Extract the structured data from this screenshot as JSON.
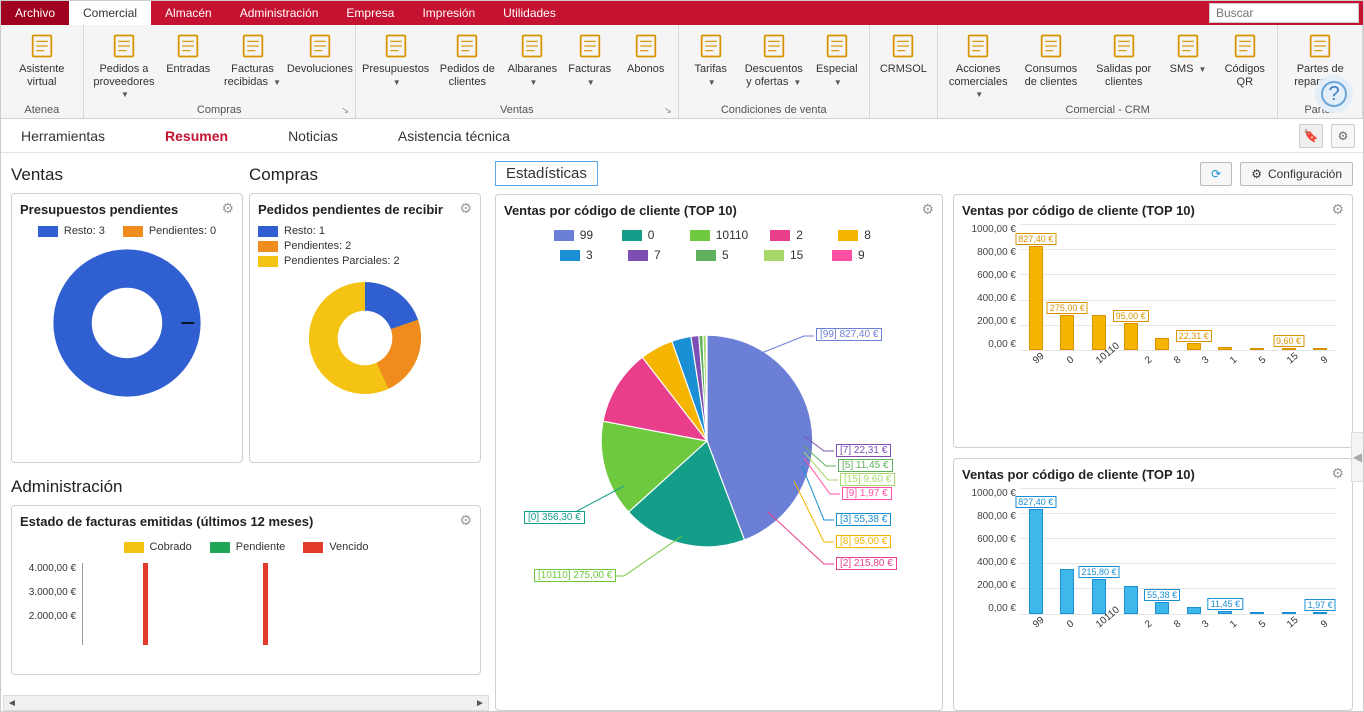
{
  "menu": {
    "items": [
      "Archivo",
      "Comercial",
      "Almacén",
      "Administración",
      "Empresa",
      "Impresión",
      "Utilidades"
    ],
    "active": 1,
    "search_placeholder": "Buscar"
  },
  "ribbon": {
    "groups": [
      {
        "title": "Atenea",
        "buttons": [
          {
            "name": "asistente-virtual",
            "label": "Asistente virtual"
          }
        ]
      },
      {
        "title": "Compras",
        "dlg": true,
        "buttons": [
          {
            "name": "pedidos-proveedores",
            "label": "Pedidos a proveedores",
            "caret": true
          },
          {
            "name": "entradas",
            "label": "Entradas"
          },
          {
            "name": "facturas-recibidas",
            "label": "Facturas recibidas",
            "caret": true
          },
          {
            "name": "devoluciones",
            "label": "Devoluciones"
          }
        ]
      },
      {
        "title": "Ventas",
        "dlg": true,
        "buttons": [
          {
            "name": "presupuestos",
            "label": "Presupuestos",
            "caret": true
          },
          {
            "name": "pedidos-clientes",
            "label": "Pedidos de clientes"
          },
          {
            "name": "albaranes",
            "label": "Albaranes",
            "caret": true
          },
          {
            "name": "facturas",
            "label": "Facturas",
            "caret": true
          },
          {
            "name": "abonos",
            "label": "Abonos"
          }
        ]
      },
      {
        "title": "Condiciones de venta",
        "buttons": [
          {
            "name": "tarifas",
            "label": "Tarifas",
            "caret": true
          },
          {
            "name": "descuentos-ofertas",
            "label": "Descuentos y ofertas",
            "caret": true
          },
          {
            "name": "especial",
            "label": "Especial",
            "caret": true
          }
        ]
      },
      {
        "title": "",
        "buttons": [
          {
            "name": "crmsol",
            "label": "CRMSOL"
          }
        ]
      },
      {
        "title": "Comercial - CRM",
        "buttons": [
          {
            "name": "acciones-comerciales",
            "label": "Acciones comerciales",
            "caret": true
          },
          {
            "name": "consumos-clientes",
            "label": "Consumos de clientes"
          },
          {
            "name": "salidas-clientes",
            "label": "Salidas por clientes"
          },
          {
            "name": "sms",
            "label": "SMS",
            "caret": true
          },
          {
            "name": "codigos-qr",
            "label": "Códigos QR"
          }
        ]
      },
      {
        "title": "Partes",
        "buttons": [
          {
            "name": "partes-reparacion",
            "label": "Partes de reparación",
            "caret": true
          }
        ]
      }
    ]
  },
  "subnav": {
    "tabs": [
      "Herramientas",
      "Resumen",
      "Noticias",
      "Asistencia técnica"
    ],
    "active": 1
  },
  "left": {
    "ventas_title": "Ventas",
    "compras_title": "Compras",
    "admin_title": "Administración",
    "presupuestos": {
      "title": "Presupuestos pendientes",
      "legend": [
        {
          "label": "Resto: 3",
          "color": "#2f5fd0"
        },
        {
          "label": "Pendientes: 0",
          "color": "#f08b1d"
        }
      ]
    },
    "pedidos": {
      "title": "Pedidos pendientes de recibir",
      "legend": [
        {
          "label": "Resto: 1",
          "color": "#2f5fd0"
        },
        {
          "label": "Pendientes: 2",
          "color": "#f08b1d"
        },
        {
          "label": "Pendientes Parciales: 2",
          "color": "#f4c313"
        }
      ]
    },
    "facturas": {
      "title": "Estado de facturas emitidas (últimos 12 meses)",
      "legend": [
        {
          "label": "Cobrado",
          "color": "#f4c313"
        },
        {
          "label": "Pendiente",
          "color": "#1fa556"
        },
        {
          "label": "Vencido",
          "color": "#e23b2e"
        }
      ],
      "ylabels": [
        "4.000,00 €",
        "3.000,00 €",
        "2.000,00 €"
      ]
    }
  },
  "stats": {
    "title": "Estadísticas",
    "config_label": "Configuración",
    "pie": {
      "title": "Ventas por código de cliente (TOP 10)",
      "legend": [
        {
          "label": "99",
          "color": "#6b7fd7"
        },
        {
          "label": "0",
          "color": "#149e8a"
        },
        {
          "label": "10110",
          "color": "#6fc93f"
        },
        {
          "label": "2",
          "color": "#e83e8c"
        },
        {
          "label": "8",
          "color": "#f4b400"
        },
        {
          "label": "3",
          "color": "#1b8fd4"
        },
        {
          "label": "7",
          "color": "#7d4fb3"
        },
        {
          "label": "5",
          "color": "#5fb15f"
        },
        {
          "label": "15",
          "color": "#a7d96a"
        },
        {
          "label": "9",
          "color": "#ff4fa3"
        }
      ],
      "callouts": [
        {
          "text": "[99] 827,40 €",
          "color": "#6b7fd7"
        },
        {
          "text": "[7] 22,31 €",
          "color": "#7d4fb3"
        },
        {
          "text": "[5] 11,45 €",
          "color": "#5fb15f"
        },
        {
          "text": "[15] 9,60 €",
          "color": "#a7d96a"
        },
        {
          "text": "[9] 1,97 €",
          "color": "#ff4fa3"
        },
        {
          "text": "[3] 55,38 €",
          "color": "#1b8fd4"
        },
        {
          "text": "[8] 95,00 €",
          "color": "#f4b400"
        },
        {
          "text": "[2] 215,80 €",
          "color": "#e83e8c"
        },
        {
          "text": "[10110] 275,00 €",
          "color": "#6fc93f"
        },
        {
          "text": "[0] 356,30 €",
          "color": "#149e8a"
        }
      ]
    },
    "bar1": {
      "title": "Ventas por código de cliente (TOP 10)",
      "color": "#f4b400",
      "border": "#d89400"
    },
    "bar2": {
      "title": "Ventas por código de cliente (TOP 10)",
      "color": "#3db8e8",
      "border": "#1b8fd4"
    }
  },
  "chart_data": [
    {
      "type": "donut",
      "title": "Presupuestos pendientes",
      "series": [
        {
          "name": "Resto",
          "value": 3
        },
        {
          "name": "Pendientes",
          "value": 0
        }
      ]
    },
    {
      "type": "donut",
      "title": "Pedidos pendientes de recibir",
      "series": [
        {
          "name": "Resto",
          "value": 1
        },
        {
          "name": "Pendientes",
          "value": 2
        },
        {
          "name": "Pendientes Parciales",
          "value": 2
        }
      ]
    },
    {
      "type": "bar",
      "title": "Estado de facturas emitidas (últimos 12 meses)",
      "series": [
        {
          "name": "Cobrado"
        },
        {
          "name": "Pendiente"
        },
        {
          "name": "Vencido"
        }
      ],
      "ylim": [
        0,
        4000
      ],
      "ylabel": "€"
    },
    {
      "type": "pie",
      "title": "Ventas por código de cliente (TOP 10)",
      "categories": [
        "99",
        "0",
        "10110",
        "2",
        "8",
        "3",
        "7",
        "5",
        "15",
        "9"
      ],
      "values": [
        827.4,
        356.3,
        275.0,
        215.8,
        95.0,
        55.38,
        22.31,
        11.45,
        9.6,
        1.97
      ],
      "unit": "€"
    },
    {
      "type": "bar",
      "title": "Ventas por código de cliente (TOP 10)",
      "categories": [
        "99",
        "0",
        "10110",
        "2",
        "8",
        "3",
        "1",
        "5",
        "15",
        "9"
      ],
      "values": [
        827.4,
        275.0,
        275.0,
        215.8,
        95.0,
        55.38,
        22.31,
        11.45,
        9.6,
        1.97
      ],
      "value_labels": [
        "827,40 €",
        "275,00 €",
        "",
        "95,00 €",
        "",
        "22,31 €",
        "",
        "",
        "9,60 €",
        ""
      ],
      "ylim": [
        0,
        1000
      ],
      "ytick": 200,
      "ylabel": "€"
    },
    {
      "type": "bar",
      "title": "Ventas por código de cliente (TOP 10)",
      "categories": [
        "99",
        "0",
        "10110",
        "2",
        "8",
        "3",
        "1",
        "5",
        "15",
        "9"
      ],
      "values": [
        827.4,
        356.3,
        275.0,
        215.8,
        95.0,
        55.38,
        22.31,
        11.45,
        9.6,
        1.97
      ],
      "value_labels": [
        "827,40 €",
        "",
        "215,80 €",
        "",
        "55,38 €",
        "",
        "11,45 €",
        "",
        "",
        "1,97 €"
      ],
      "ylim": [
        0,
        1000
      ],
      "ytick": 200,
      "ylabel": "€"
    }
  ]
}
